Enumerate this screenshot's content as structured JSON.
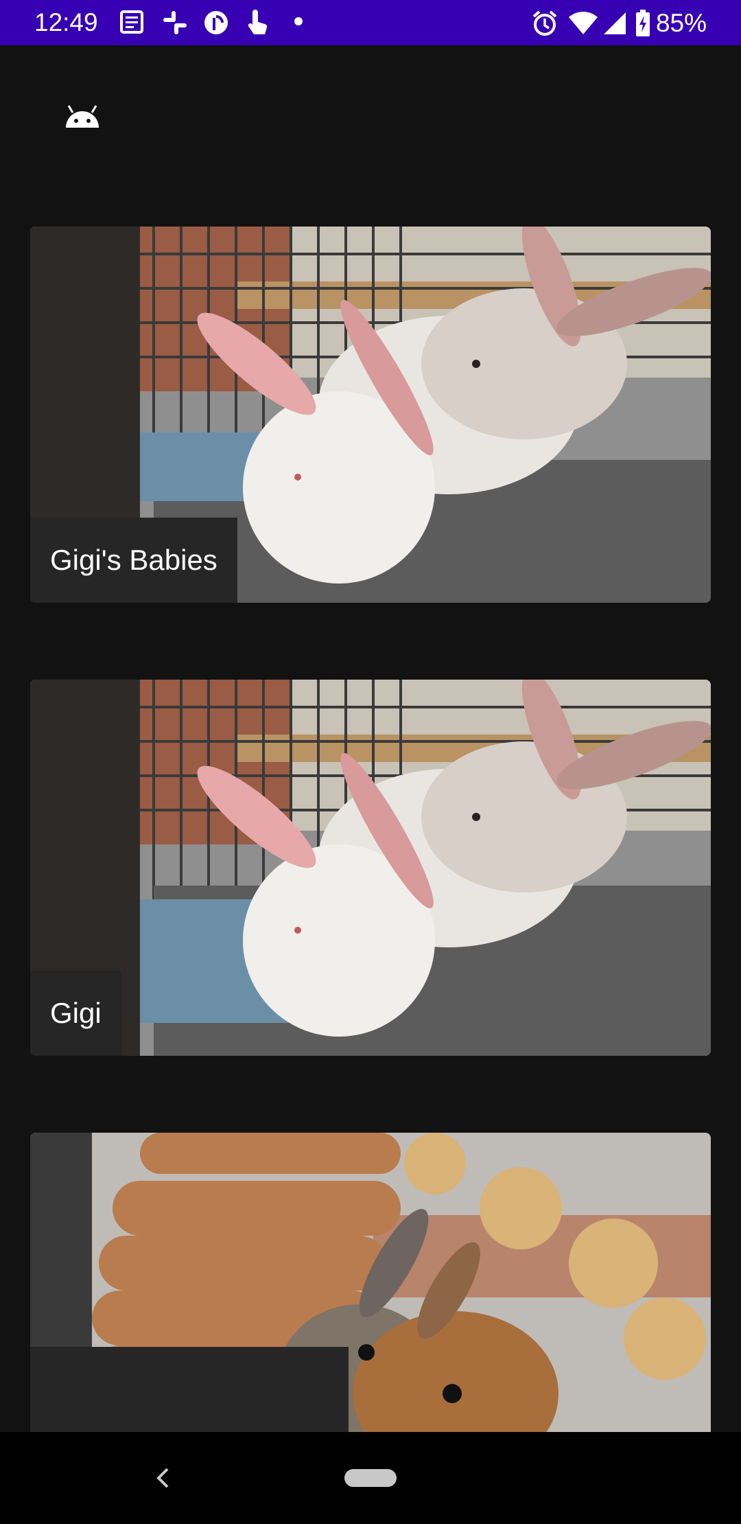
{
  "status_bar": {
    "time": "12:49",
    "battery_percent": "85%",
    "notification_icons": [
      "news-icon",
      "slack-icon",
      "pocket-casts-icon",
      "touch-icon",
      "dot-icon"
    ],
    "system_icons": [
      "alarm-icon",
      "wifi-icon",
      "signal-icon",
      "battery-charging-icon"
    ],
    "color": "#3700b3"
  },
  "app": {
    "icon": "android-icon"
  },
  "cards": [
    {
      "label": "Gigi's Babies",
      "image": "two-white-rabbits"
    },
    {
      "label": "Gigi",
      "image": "two-white-rabbits"
    },
    {
      "label": "",
      "image": "brown-rabbits-with-chew-logs"
    }
  ],
  "nav_bar": {
    "back_icon": "chevron-left-icon",
    "home_icon": "home-pill-icon"
  }
}
